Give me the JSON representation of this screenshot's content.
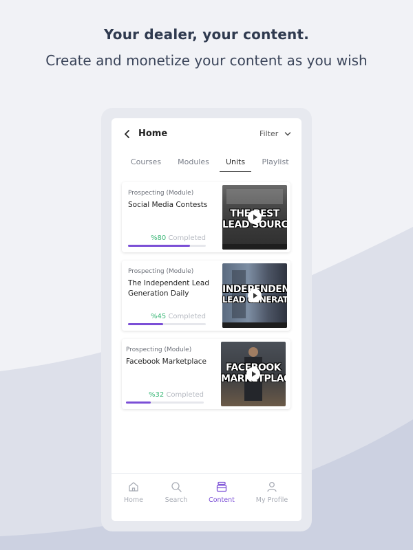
{
  "promo": {
    "headline": "Your dealer, your content.",
    "subheadline": "Create and monetize your content as you wish"
  },
  "topbar": {
    "title": "Home",
    "filter_label": "Filter"
  },
  "tabs": [
    {
      "label": "Courses",
      "active": false
    },
    {
      "label": "Modules",
      "active": false
    },
    {
      "label": "Units",
      "active": true
    },
    {
      "label": "Playlist",
      "active": false
    }
  ],
  "cards": [
    {
      "module": "Prospecting (Module)",
      "title": "Social Media Contests",
      "percent_text": "%80",
      "completed_word": "Completed",
      "progress": 0.8,
      "thumb_line1": "THE BEST",
      "thumb_line2": "LEAD SOURCE"
    },
    {
      "module": "Prospecting (Module)",
      "title": "The Independent Lead Generation Daily",
      "percent_text": "%45",
      "completed_word": "Completed",
      "progress": 0.45,
      "thumb_line1": "INDEPENDENT",
      "thumb_line2": "LEAD GENERATION"
    },
    {
      "module": "Prospecting (Module)",
      "title": "Facebook Marketplace",
      "percent_text": "%32",
      "completed_word": "Completed",
      "progress": 0.32,
      "thumb_line1": "FACEBOOK",
      "thumb_line2": "MARKETPLACE"
    }
  ],
  "bottom_nav": [
    {
      "label": "Home",
      "icon": "home-icon",
      "active": false
    },
    {
      "label": "Search",
      "icon": "search-icon",
      "active": false
    },
    {
      "label": "Content",
      "icon": "content-stack-icon",
      "active": true
    },
    {
      "label": "My Profile",
      "icon": "profile-icon",
      "active": false
    }
  ],
  "colors": {
    "accent": "#7b4fd6",
    "progress_text": "#3bb777",
    "background": "#f1f2f6",
    "wave": "#d7dbe7"
  }
}
